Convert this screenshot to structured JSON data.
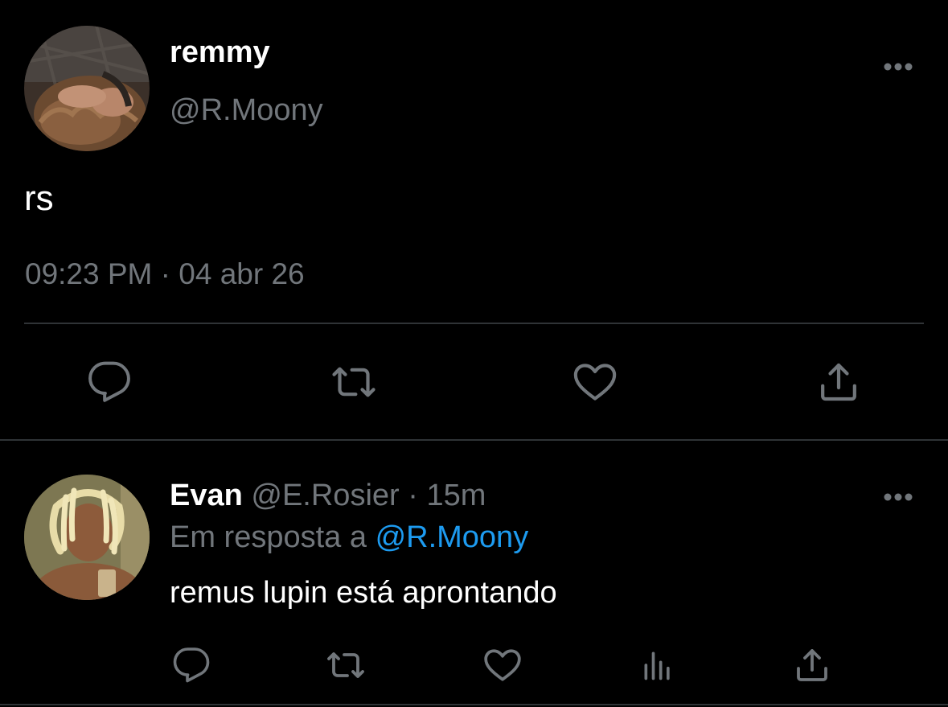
{
  "main_tweet": {
    "display_name": "remmy",
    "handle": "@R.Moony",
    "text": "rs",
    "time": "09:23 PM",
    "separator": "·",
    "date": "04 abr 26",
    "actions": [
      "reply-icon",
      "retweet-icon",
      "like-icon",
      "share-icon"
    ]
  },
  "reply": {
    "display_name": "Evan",
    "handle": "@E.Rosier",
    "separator": "·",
    "time_ago": "15m",
    "in_reply_to_label": "Em resposta a",
    "in_reply_to_handle": "@R.Moony",
    "text": "remus lupin está aprontando",
    "actions": [
      "reply-icon",
      "retweet-icon",
      "like-icon",
      "analytics-icon",
      "share-icon"
    ]
  },
  "colors": {
    "background": "#000000",
    "primary_text": "#ffffff",
    "secondary_text": "#71767b",
    "accent": "#1d9bf0",
    "divider": "#2f3336"
  }
}
